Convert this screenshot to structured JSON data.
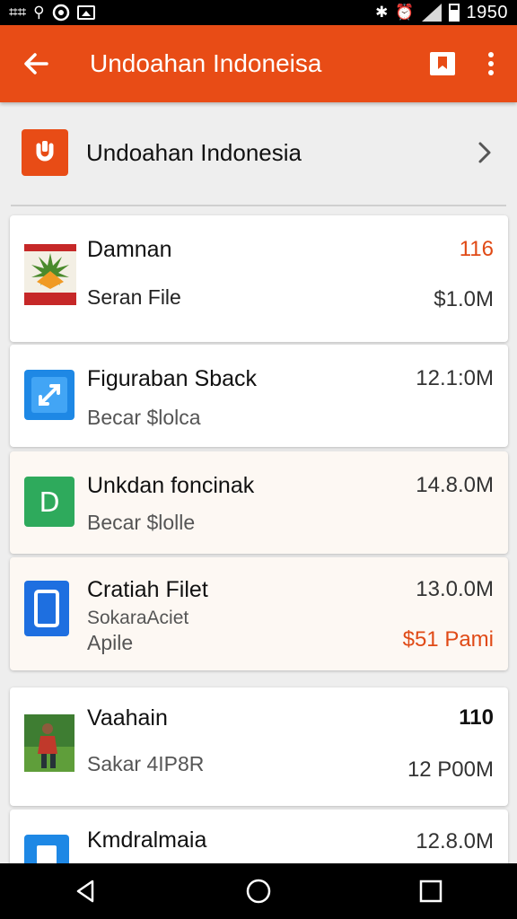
{
  "status_bar": {
    "icons": [
      "notification-glyphs-icon",
      "gallery-icon",
      "whatsapp-icon",
      "image-icon",
      "bluetooth-icon",
      "alarm-icon",
      "signal-icon",
      "battery-icon"
    ],
    "left_glyph_1": "⌗⌗",
    "left_glyph_2": "⚲",
    "bt_glyph": "✱",
    "alarm_glyph": "⏰",
    "time": "1950"
  },
  "app_bar": {
    "title": "Undoahan Indoneisa",
    "color": "#e84c16"
  },
  "section": {
    "title": "Undoahan Indonesia"
  },
  "items": [
    {
      "title": "Damnan",
      "subtitle": "Seran File",
      "value_top": "116",
      "value_bottom": "$1.0M",
      "icon": "flag-landscape-icon"
    },
    {
      "title": "Figuraban Sback",
      "subtitle": "Becar $lolca",
      "value_top": "12.1:0M",
      "icon": "blue-app-icon"
    },
    {
      "title": "Unkdan foncinak",
      "subtitle": "Becar $lolle",
      "value_top": "14.8.0M",
      "icon": "green-d-icon"
    },
    {
      "title": "Cratiah Filet",
      "subtitle": "SokaraAciet",
      "subtitle2": "Apile",
      "value_top": "13.0.0M",
      "value_bottom": "$51 Pami",
      "icon": "blue-document-icon"
    },
    {
      "title": "Vaahain",
      "subtitle": "Sakar 4IP8R",
      "value_top": "110",
      "value_bottom": "12 P00M",
      "icon": "photo-person-icon"
    },
    {
      "title": "Kmdralmaia",
      "value_top": "12.8.0M",
      "icon": "blue-note-icon"
    }
  ],
  "colors": {
    "accent": "#e84c16",
    "blue": "#1e88e5",
    "green": "#2eaa5c"
  }
}
